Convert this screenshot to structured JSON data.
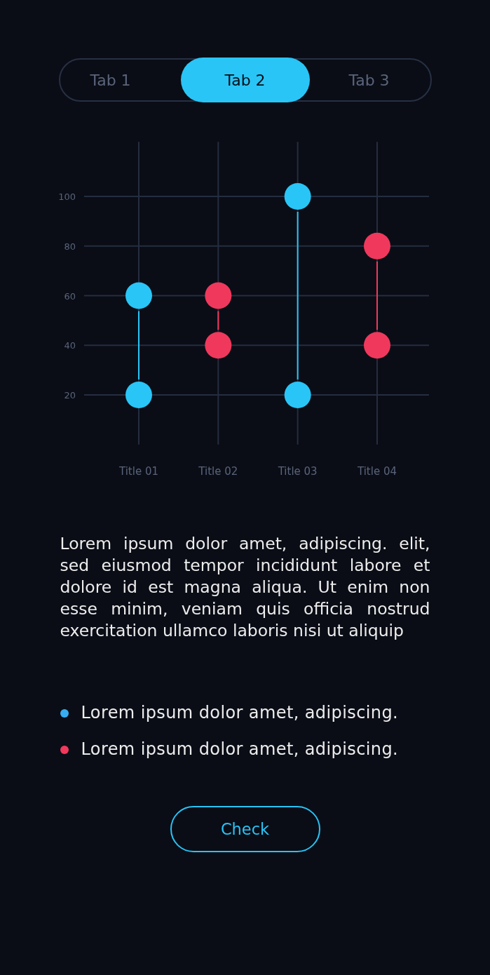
{
  "tabs": [
    {
      "label": "Tab 1",
      "selected": false
    },
    {
      "label": "Tab 2",
      "selected": true
    },
    {
      "label": "Tab 3",
      "selected": false
    }
  ],
  "chart": {
    "chart_data": {
      "type": "scatter",
      "categories": [
        "Title 01",
        "Title 02",
        "Title 03",
        "Title 04"
      ],
      "series": [
        {
          "color": "#29c5f6",
          "values": [
            60,
            null,
            100,
            null
          ]
        },
        {
          "color": "#29c5f6",
          "values": [
            20,
            null,
            20,
            null
          ]
        },
        {
          "color": "#f0385c",
          "values": [
            null,
            60,
            null,
            80
          ]
        },
        {
          "color": "#f0385c",
          "values": [
            null,
            40,
            null,
            40
          ]
        }
      ],
      "ylim": [
        0,
        122
      ],
      "yticks": [
        20,
        40,
        60,
        80,
        100
      ],
      "grid": true
    }
  },
  "description": "Lorem ipsum dolor amet, adipiscing. elit, sed eiusmod tempor incididunt labore et dolore id est magna aliqua. Ut enim non esse minim, veniam quis officia nostrud exercitation ullamco laboris nisi ut aliquip",
  "legend": [
    {
      "label": "Lorem ipsum dolor amet, adipiscing.",
      "color": "#38aef0"
    },
    {
      "label": "Lorem ipsum dolor amet, adipiscing.",
      "color": "#f0395c"
    }
  ],
  "check_button": {
    "label": "Check"
  }
}
